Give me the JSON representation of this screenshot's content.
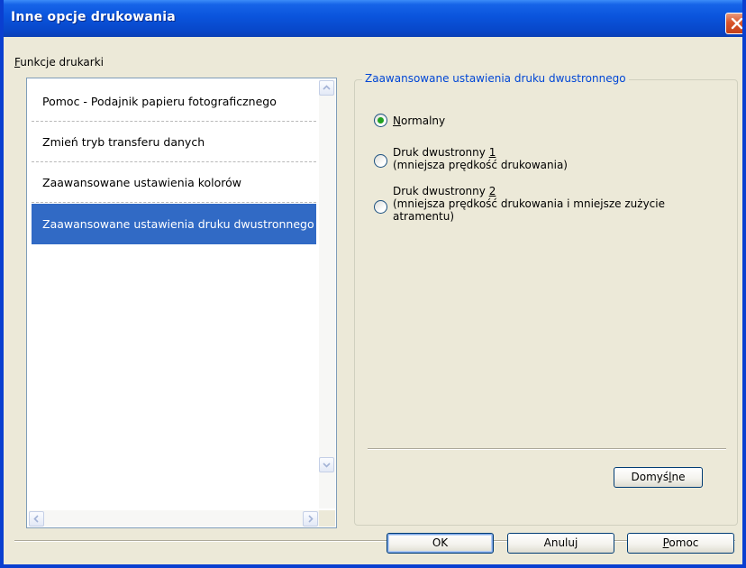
{
  "window": {
    "title": "Inne opcje drukowania"
  },
  "sidebar": {
    "section_label_first": "F",
    "section_label_rest": "unkcje drukarki",
    "items": [
      {
        "label": "Pomoc - Podajnik papieru fotograficznego",
        "selected": false
      },
      {
        "label": "Zmień tryb transferu danych",
        "selected": false
      },
      {
        "label": "Zaawansowane ustawienia kolorów",
        "selected": false
      },
      {
        "label": "Zaawansowane ustawienia druku dwustronnego",
        "selected": true
      }
    ]
  },
  "panel": {
    "group_title": "Zaawansowane ustawienia druku dwustronnego",
    "options": [
      {
        "accel": "N",
        "rest": "ormalny",
        "selected": true
      },
      {
        "line1_prefix": "Druk dwustronny ",
        "accel": "1",
        "line2": "(mniejsza prędkość drukowania)",
        "selected": false
      },
      {
        "line1_prefix": "Druk dwustronny ",
        "accel": "2",
        "line2": "(mniejsza prędkość drukowania i mniejsze zużycie",
        "line3": "atramentu)",
        "selected": false
      }
    ],
    "defaults_button": {
      "prefix": "Domyś",
      "accel": "l",
      "suffix": "ne"
    }
  },
  "footer": {
    "ok_label": "OK",
    "cancel_label": "Anuluj",
    "help_accel": "P",
    "help_rest": "omoc"
  },
  "colors": {
    "title_bar": "#0a54dc",
    "selection": "#316ac5",
    "group_title": "#0046d5",
    "radio_dot": "#21a121",
    "dialog_bg": "#ece9d8"
  },
  "icons": {
    "close": "close-icon",
    "scroll_up": "chevron-up-icon",
    "scroll_down": "chevron-down-icon",
    "scroll_left": "chevron-left-icon",
    "scroll_right": "chevron-right-icon"
  }
}
